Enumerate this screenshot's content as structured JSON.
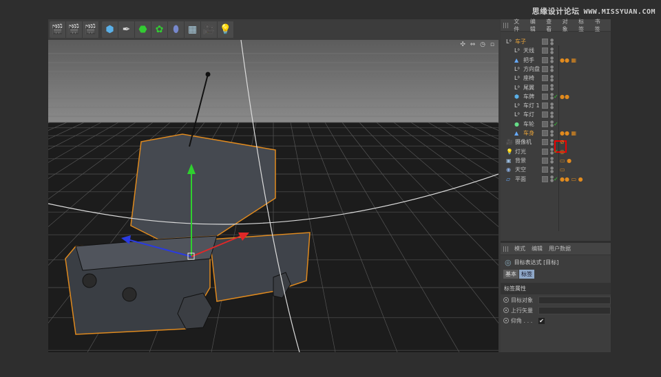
{
  "watermark": {
    "cn": "思缘设计论坛",
    "url": "WWW.MISSYUAN.COM"
  },
  "toolbar": {
    "groups": [
      [
        "clapper-icon",
        "clapper-edit-icon",
        "clapper-settings-icon"
      ],
      [
        "cube-icon",
        "pen-icon",
        "subdivision-icon",
        "array-icon",
        "deformer-icon",
        "floor-icon",
        "camera-icon",
        "light-icon"
      ]
    ]
  },
  "viewport": {
    "nav_icons": "✣ ⇔ ◷ ▫"
  },
  "object_manager": {
    "menu": [
      "文件",
      "编辑",
      "查看",
      "对象",
      "标签",
      "书签"
    ],
    "rows": [
      {
        "name": "车子",
        "depth": 0,
        "icon": "null-icon",
        "selected": true,
        "check": false,
        "tags": ""
      },
      {
        "name": "天线",
        "depth": 1,
        "icon": "null-icon",
        "check": false,
        "tags": ""
      },
      {
        "name": "把手",
        "depth": 1,
        "icon": "polygon-icon",
        "check": false,
        "tags": "●● ▦"
      },
      {
        "name": "方向盘",
        "depth": 1,
        "icon": "null-icon",
        "check": false,
        "tags": ""
      },
      {
        "name": "座椅",
        "depth": 1,
        "icon": "null-icon",
        "check": false,
        "tags": ""
      },
      {
        "name": "尾翼",
        "depth": 1,
        "icon": "null-icon",
        "check": false,
        "tags": ""
      },
      {
        "name": "车牌",
        "depth": 1,
        "icon": "cube-icon",
        "check": true,
        "tags": "●●"
      },
      {
        "name": "车灯 1",
        "depth": 1,
        "icon": "null-icon",
        "check": false,
        "tags": ""
      },
      {
        "name": "车灯",
        "depth": 1,
        "icon": "null-icon",
        "check": false,
        "tags": ""
      },
      {
        "name": "车轮",
        "depth": 1,
        "icon": "sphere-icon",
        "check": true,
        "tags": ""
      },
      {
        "name": "车身",
        "depth": 1,
        "icon": "polygon-icon",
        "selected": true,
        "check": false,
        "tags": "●● ▦"
      },
      {
        "name": "摄像机",
        "depth": 0,
        "icon": "camera-icon",
        "check": false,
        "tags": "⊘"
      },
      {
        "name": "灯光",
        "depth": 0,
        "icon": "light-icon",
        "check": true,
        "tags": "◎"
      },
      {
        "name": "背景",
        "depth": 0,
        "icon": "background-icon",
        "check": false,
        "tags": "▭ ●"
      },
      {
        "name": "天空",
        "depth": 0,
        "icon": "sky-icon",
        "check": false,
        "tags": "▭"
      },
      {
        "name": "平面",
        "depth": 0,
        "icon": "plane-icon",
        "check": true,
        "tags": "●● ▭ ●"
      }
    ]
  },
  "attributes": {
    "menu": [
      "模式",
      "编辑",
      "用户数据"
    ],
    "title": "目标表达式 [目标]",
    "tabs": [
      "基本",
      "标签"
    ],
    "active_tab": "标签",
    "section": "标签属性",
    "fields": [
      {
        "label": "目标对象",
        "value": ""
      },
      {
        "label": "上行矢量",
        "value": ""
      }
    ],
    "checkbox": {
      "label": "仰角 . . .",
      "checked": "✔"
    }
  },
  "colors": {
    "selected": "#e8a33a",
    "highlight": "#e00000",
    "tab_active": "#8fa8c8",
    "bbox": "#e08a1e"
  }
}
